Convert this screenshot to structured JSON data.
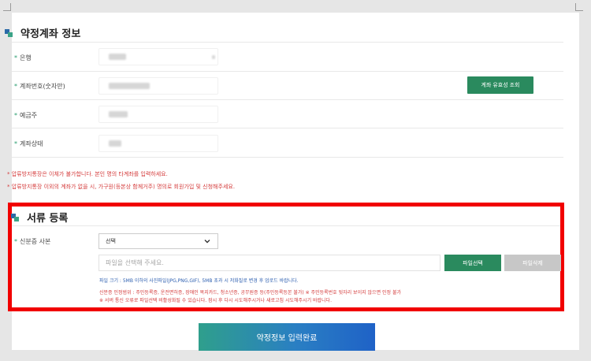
{
  "account_section": {
    "title": "약정계좌 정보",
    "fields": [
      {
        "label": "은행",
        "required": "*"
      },
      {
        "label": "계좌번호(숫자만)",
        "required": "*"
      },
      {
        "label": "예금주",
        "required": "*"
      },
      {
        "label": "계좌상태",
        "required": "*"
      }
    ],
    "verify_button": "계좌 유효성 조회",
    "notices": [
      "* 압류방지통장은 이체가 불가합니다. 본인 명의 타계좌를 입력하세요.",
      "* 압류방지통장 이외의 계좌가 없을 시, 가구원(등본상 함께거주) 명의로 회원가입 및 신청해주세요."
    ]
  },
  "document_section": {
    "title": "서류 등록",
    "id_label": "신분증 사본",
    "required": "*",
    "select_value": "선택",
    "file_placeholder": "파일을 선택해 주세요.",
    "file_select_button": "파일선택",
    "file_delete_button": "파일삭제",
    "hint_size": "파일 크기 : 5MB 이하의 사진파일(JPG,PNG,GIF), 5MB 초과 시 저화질로 변경 후 업로드 바랍니다.",
    "hint_id_range": "신분증 인정범위 : 주민등록증, 운전면허증, 장애인 복지카드, 청소년증, 공무원증 등(주민등록등본 불가)     ※ 주민등록번호 뒷자리 보이지 않으면 인정 불가",
    "hint_error": "※ 서버 통신 오류로 파일선택 비활성화될 수 있습니다. 잠시 후 다시 시도해주시거나 새로고침 시도해주시기 바랍니다."
  },
  "submit_button": "약정정보 입력완료",
  "colors": {
    "green": "#2a8a5e",
    "highlight_red": "#f10000",
    "notice_red": "#d43b3b",
    "hint_blue": "#2d5fb0"
  }
}
